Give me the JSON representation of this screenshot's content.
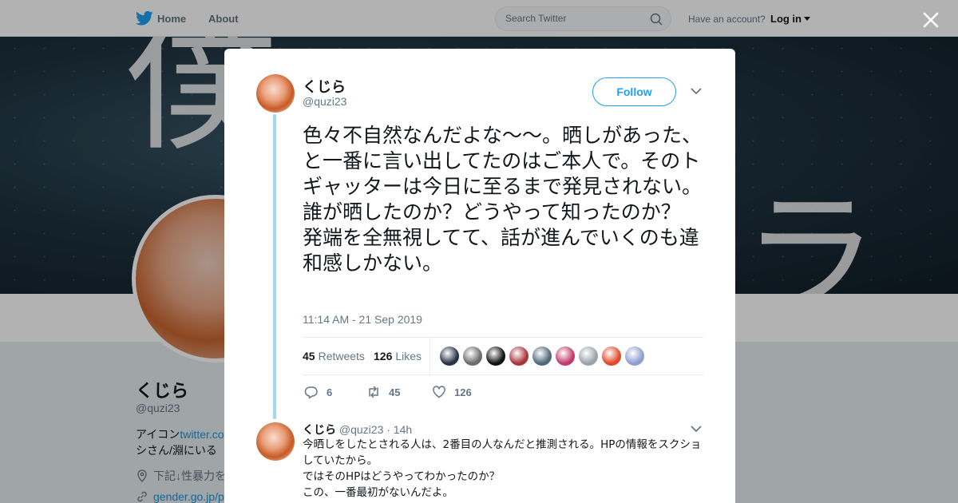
{
  "nav": {
    "home": "Home",
    "about": "About",
    "search_placeholder": "Search Twitter",
    "have_account": "Have an account?",
    "login": "Log in"
  },
  "banner": {
    "text_left": "僕",
    "text_right": "ラ"
  },
  "profile": {
    "name": "くじら",
    "handle": "@quzi23",
    "bio_prefix": "アイコン",
    "bio_link": "twitter.co",
    "bio_suffix": "シさん/淵にいる",
    "location": "下記↓性暴力を",
    "url": "gender.go.jp/p"
  },
  "tweet": {
    "name": "くじら",
    "handle": "@quzi23",
    "follow_label": "Follow",
    "text": "色々不自然なんだよな〜〜。晒しがあった、と一番に言い出してたのはご本人で。そのトギャッターは今日に至るまで発見されない。誰が晒したのか？どうやって知ったのか？\n発端を全無視してて、話が進んでいくのも違和感しかない。",
    "timestamp": "11:14 AM - 21 Sep 2019",
    "retweets_count": "45",
    "retweets_label": "Retweets",
    "likes_count": "126",
    "likes_label": "Likes",
    "reply_count": "6",
    "retweet_action_count": "45",
    "like_action_count": "126"
  },
  "likers": [
    {
      "icon": "liker-avatar",
      "color": "#2a3345"
    },
    {
      "icon": "liker-avatar",
      "color": "#6b6b6b"
    },
    {
      "icon": "liker-avatar",
      "color": "#111111"
    },
    {
      "icon": "liker-avatar",
      "color": "#a8343c"
    },
    {
      "icon": "liker-avatar",
      "color": "#4e6a7a"
    },
    {
      "icon": "liker-avatar",
      "color": "#c43a6a"
    },
    {
      "icon": "liker-avatar",
      "color": "#9aa3ab"
    },
    {
      "icon": "liker-avatar",
      "color": "#e04a2a"
    },
    {
      "icon": "liker-avatar",
      "color": "#8f9fcf"
    }
  ],
  "reply": {
    "name": "くじら",
    "handle": "@quzi23",
    "time": "· 14h",
    "line1": "今晒しをしたとされる人は、2番目の人なんだと推測される。HPの情報をスクショしていたから。",
    "line2": "ではそのHPはどうやってわかったのか？",
    "line3": "この、一番最初がないんだよ。"
  },
  "colors": {
    "accent": "#1da1f2",
    "thread_line": "#a4d9f3",
    "muted": "#657786"
  }
}
